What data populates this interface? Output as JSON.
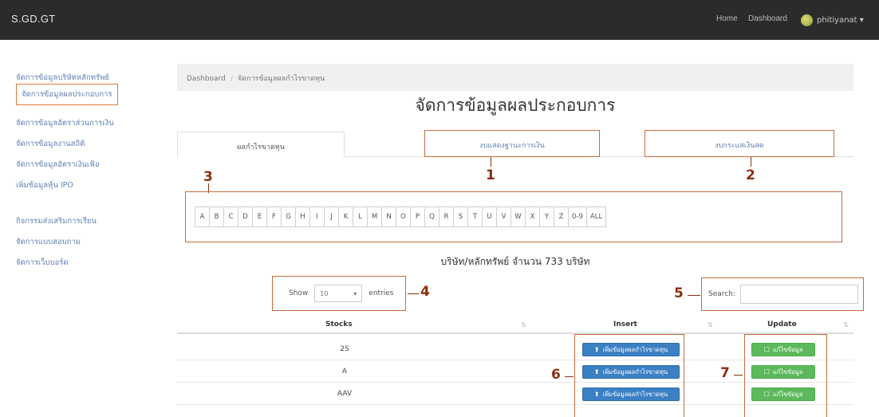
{
  "navbar": {
    "brand": "S.GD.GT",
    "links": [
      "Home",
      "Dashboard"
    ],
    "user": "phitiyanat ▾"
  },
  "sidebar": {
    "items": [
      "จัดการข้อมูลบริษัทหลักทรัพย์",
      "จัดการข้อมูลผลประกอบการ",
      "จัดการข้อมูลอัตราส่วนการเงิน",
      "จัดการข้อมูลงานสถิติ",
      "จัดการข้อมูลอัตราเงินเฟ้อ",
      "เพิ่มข้อมูลหุ้น IPO",
      "กิจกรรมส่งเสริมการเรียน",
      "จัดการแบบสอบถาม",
      "จัดการเว็บบอร์ด"
    ]
  },
  "breadcrumb": {
    "root": "Dashboard",
    "current": "จัดการข้อมูลผลกำไรขาดทุน"
  },
  "page": {
    "title": "จัดการข้อมูลผลประกอบการ",
    "company_count": "บริษัท/หลักทรัพย์ จำนวน 733 บริษัท"
  },
  "tabs": [
    {
      "label": "ผลกำไรขาดทุน",
      "active": true
    },
    {
      "label": "งบแสดงฐานะการเงิน",
      "active": false
    },
    {
      "label": "งบกระแสเงินสด",
      "active": false
    }
  ],
  "letters": [
    "A",
    "B",
    "C",
    "D",
    "E",
    "F",
    "G",
    "H",
    "I",
    "J",
    "K",
    "L",
    "M",
    "N",
    "O",
    "P",
    "Q",
    "R",
    "S",
    "T",
    "U",
    "V",
    "W",
    "X",
    "Y",
    "Z",
    "0-9",
    "ALL"
  ],
  "annotations": [
    "1",
    "2",
    "3",
    "4",
    "5",
    "6",
    "7"
  ],
  "table_controls": {
    "show_label": "Show",
    "entries_value": "10",
    "entries_label": "entries",
    "search_label": "Search:"
  },
  "table": {
    "columns": [
      "Stocks",
      "Insert",
      "Update"
    ],
    "rows": [
      {
        "stock": "2S",
        "insert_label": "เพิ่มข้อมูลผลกำไรขาดทุน",
        "update_label": "แก้ไขข้อมูล"
      },
      {
        "stock": "A",
        "insert_label": "เพิ่มข้อมูลผลกำไรขาดทุน",
        "update_label": "แก้ไขข้อมูล"
      },
      {
        "stock": "AAV",
        "insert_label": "เพิ่มข้อมูลผลกำไรขาดทุน",
        "update_label": "แก้ไขข้อมูล"
      }
    ]
  },
  "colors": {
    "navbar": "#2b2b2b",
    "annotation": "#c76a3f",
    "insert_button": "#3b80c4",
    "update_button": "#5cb85c"
  }
}
